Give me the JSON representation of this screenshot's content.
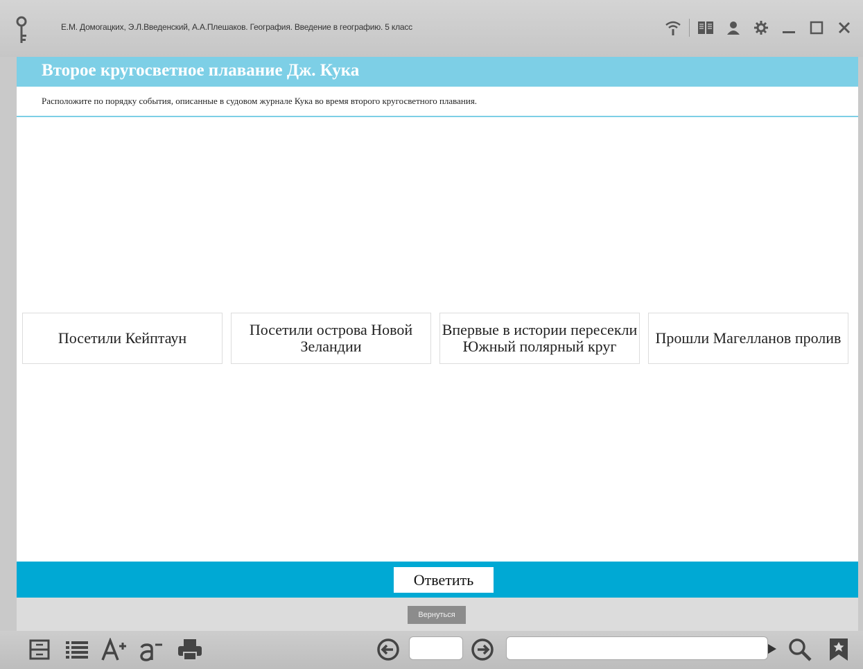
{
  "titlebar": {
    "title": "Е.М. Домогацких, Э.Л.Введенский, А.А.Плешаков. География. Введение в географию. 5 класс",
    "icons": [
      "key-icon",
      "wifi-icon",
      "book-icon",
      "user-icon",
      "settings-icon",
      "minimize-icon",
      "maximize-icon",
      "close-icon"
    ]
  },
  "header": {
    "title": "Второе кругосветное плавание Дж. Кука"
  },
  "instruction": "Расположите по порядку события, описанные в судовом журнале Кука во время второго кругосветного плавания.",
  "cards": [
    {
      "label": "Посетили Кейптаун"
    },
    {
      "label": "Посетили острова Новой Зеландии"
    },
    {
      "label": "Впервые в истории пересекли Южный полярный круг"
    },
    {
      "label": "Прошли Магелланов пролив"
    }
  ],
  "actions": {
    "answer_label": "Ответить",
    "back_label": "Вернуться"
  },
  "bottombar": {
    "page_value": "",
    "search_value": "",
    "icons": [
      "layout-icon",
      "list-icon",
      "font-increase-icon",
      "font-decrease-icon",
      "print-icon",
      "prev-page-icon",
      "next-page-icon",
      "play-icon",
      "search-icon",
      "bookmark-icon"
    ]
  },
  "colors": {
    "header_band": "#7dcfe6",
    "answer_band": "#00a9d4",
    "back_button": "#8c8c8c",
    "frame": "#c9c9c9"
  }
}
